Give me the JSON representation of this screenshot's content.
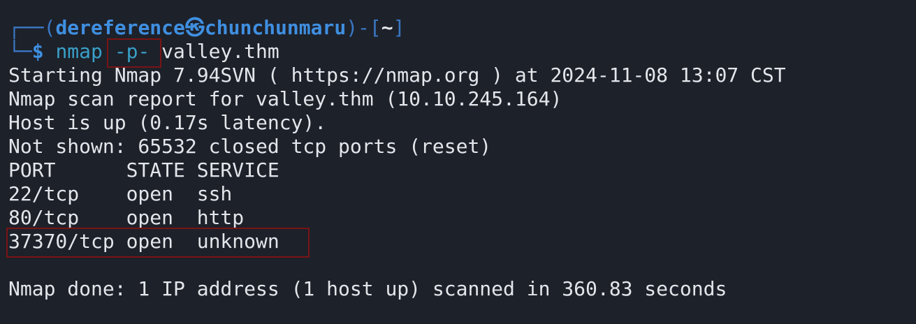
{
  "prompt": {
    "corner_top": "┌──",
    "open_paren": "(",
    "user": "dereference",
    "separator_glyph": "㉿",
    "host": "chunchunmaru",
    "close_paren": ")",
    "dash": "-",
    "open_bracket": "[",
    "cwd": "~",
    "close_bracket": "]",
    "corner_bottom": "└─",
    "dollar": "$",
    "command": "nmap",
    "flag": "-p-",
    "target": "valley.thm"
  },
  "output": [
    "Starting Nmap 7.94SVN ( https://nmap.org ) at 2024-11-08 13:07 CST",
    "Nmap scan report for valley.thm (10.10.245.164)",
    "Host is up (0.17s latency).",
    "Not shown: 65532 closed tcp ports (reset)",
    "PORT      STATE SERVICE",
    "22/tcp    open  ssh",
    "80/tcp    open  http",
    "37370/tcp open  unknown",
    "",
    "Nmap done: 1 IP address (1 host up) scanned in 360.83 seconds"
  ],
  "colors": {
    "background": "#1d212a",
    "prompt_frame": "#3a78c4",
    "user_host": "#3f8fe0",
    "command": "#39a0c9",
    "text": "#e3e6ea",
    "highlight_border": "#7a1414"
  }
}
